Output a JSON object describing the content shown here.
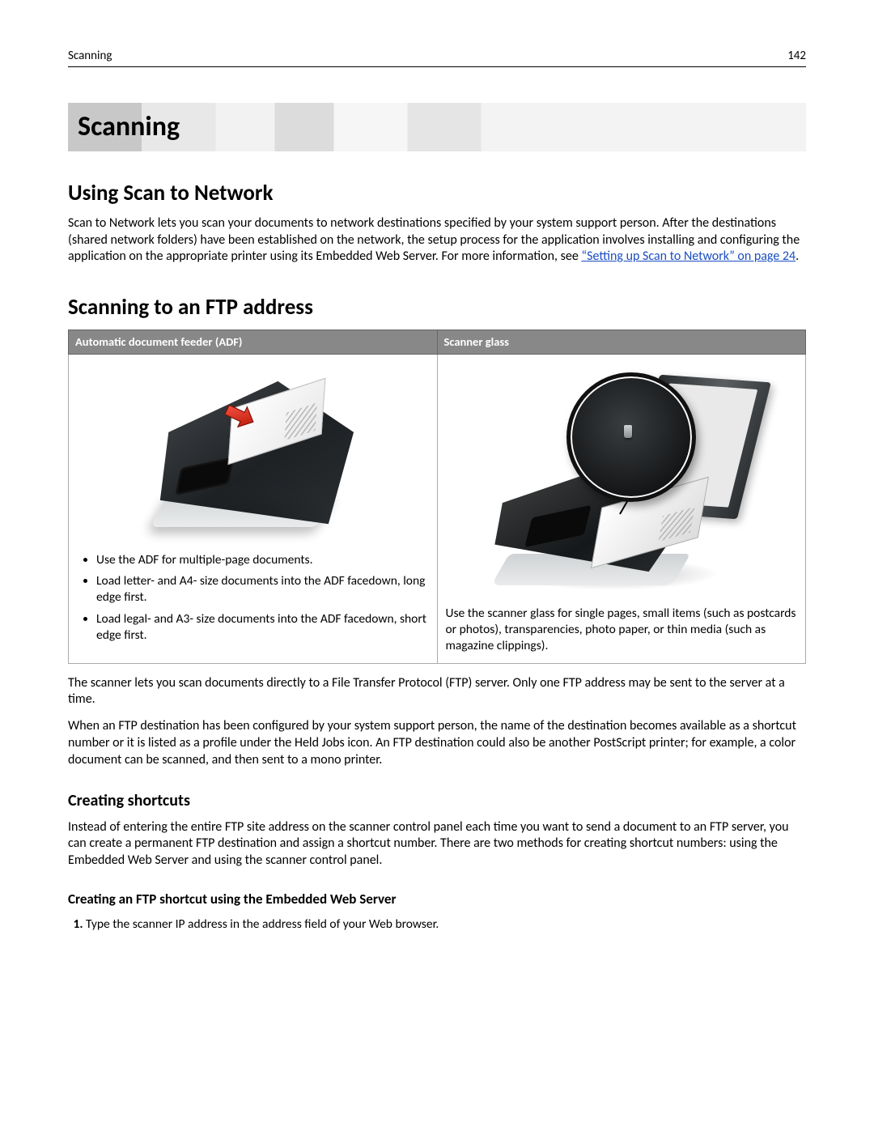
{
  "header": {
    "section": "Scanning",
    "page_number": "142"
  },
  "chapter_title": "Scanning",
  "section_scan_to_network": {
    "heading": "Using Scan to Network",
    "body_pre_link": "Scan to Network lets you scan your documents to network destinations specified by your system support person. After the destinations (shared network folders) have been established on the network, the setup process for the application involves installing and configuring the application on the appropriate printer using its Embedded Web Server. For more information, see ",
    "link_text": "“Setting up Scan to Network” on page 24",
    "body_post_link": "."
  },
  "section_ftp": {
    "heading": "Scanning to an FTP address",
    "table": {
      "col1_header": "Automatic document feeder (ADF)",
      "col2_header": "Scanner glass",
      "adf_bullets": [
        "Use the ADF for multiple-page documents.",
        "Load letter- and A4- size documents into the ADF facedown, long edge first.",
        "Load legal- and A3- size documents into the ADF facedown, short edge first."
      ],
      "glass_text": "Use the scanner glass for single pages, small items (such as postcards or photos), transparencies, photo paper, or thin media (such as magazine clippings)."
    },
    "para1": "The scanner lets you scan documents directly to a File Transfer Protocol (FTP) server. Only one FTP address may be sent to the server at a time.",
    "para2": "When an FTP destination has been configured by your system support person, the name of the destination becomes available as a shortcut number or it is listed as a profile under the Held Jobs icon. An FTP destination could also be another PostScript printer; for example, a color document can be scanned, and then sent to a mono printer."
  },
  "section_shortcuts": {
    "heading": "Creating shortcuts",
    "body": "Instead of entering the entire FTP site address on the scanner control panel each time you want to send a document to an FTP server, you can create a permanent FTP destination and assign a shortcut number. There are two methods for creating shortcut numbers: using the Embedded Web Server and using the scanner control panel."
  },
  "section_ews": {
    "heading": "Creating an FTP shortcut using the Embedded Web Server",
    "steps": [
      "Type the scanner IP address in the address field of your Web browser."
    ]
  }
}
